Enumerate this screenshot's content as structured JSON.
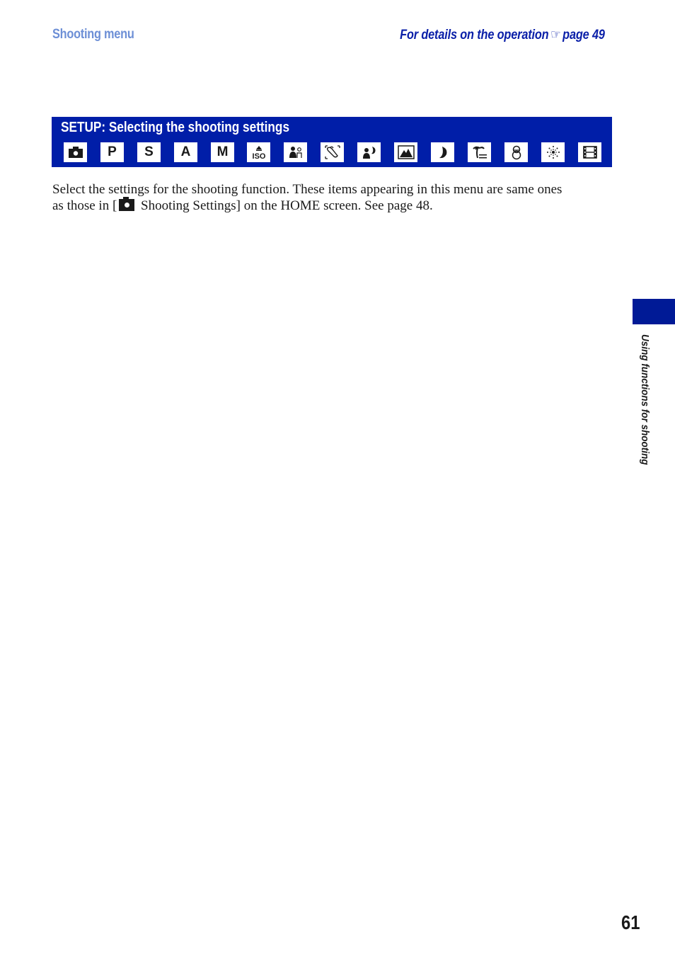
{
  "header": {
    "section_title": "Shooting menu",
    "cross_ref_prefix": "For details on the operation",
    "cross_ref_icon": "pointing-hand-icon",
    "cross_ref_glyph": "☞",
    "cross_ref_page": "page 49",
    "colors": {
      "section_title": "#6d8fd6",
      "cross_ref": "#0a1fa8"
    }
  },
  "setup_box": {
    "title": "SETUP: Selecting the shooting settings",
    "background": "#001ea8",
    "mode_icons": [
      {
        "name": "auto-camera-icon",
        "label": ""
      },
      {
        "name": "program-mode-icon",
        "label": "P"
      },
      {
        "name": "shutter-priority-icon",
        "label": "S"
      },
      {
        "name": "aperture-priority-icon",
        "label": "A"
      },
      {
        "name": "manual-mode-icon",
        "label": "M"
      },
      {
        "name": "high-sensitivity-iso-icon",
        "label": "ISO"
      },
      {
        "name": "smile-shutter-icon",
        "label": ""
      },
      {
        "name": "soft-snap-icon",
        "label": ""
      },
      {
        "name": "twilight-portrait-icon",
        "label": ""
      },
      {
        "name": "landscape-icon",
        "label": ""
      },
      {
        "name": "twilight-moon-icon",
        "label": ""
      },
      {
        "name": "beach-icon",
        "label": ""
      },
      {
        "name": "snow-icon",
        "label": ""
      },
      {
        "name": "fireworks-icon",
        "label": ""
      },
      {
        "name": "movie-mode-icon",
        "label": ""
      }
    ]
  },
  "body": {
    "line1": "Select the settings for the shooting function. These items appearing in this menu are same ones",
    "line2_prefix": "as those in [",
    "line2_icon": "camera-icon",
    "line2_suffix": " Shooting Settings] on the HOME screen. See page 48."
  },
  "side_tab": {
    "label": "Using functions for shooting",
    "color": "#001a96"
  },
  "page_number": "61"
}
